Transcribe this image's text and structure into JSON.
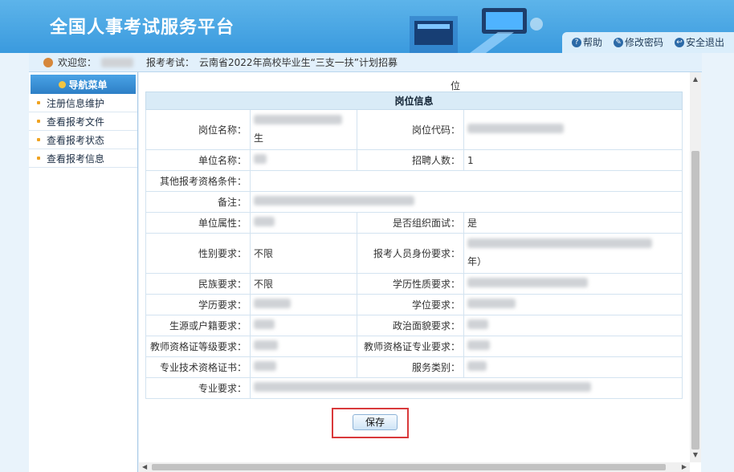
{
  "header": {
    "title": "全国人事考试服务平台",
    "links": [
      {
        "icon": "help-icon",
        "label": "帮助"
      },
      {
        "icon": "key-icon",
        "label": "修改密码"
      },
      {
        "icon": "exit-icon",
        "label": "安全退出"
      }
    ]
  },
  "welcome": {
    "greeting": "欢迎您：",
    "exam_label": "报考考试：",
    "exam_name": "云南省2022年高校毕业生“三支一扶”计划招募"
  },
  "sidebar": {
    "title": "导航菜单",
    "items": [
      {
        "label": "注册信息维护"
      },
      {
        "label": "查看报考文件"
      },
      {
        "label": "查看报考状态"
      },
      {
        "label": "查看报考信息"
      }
    ]
  },
  "content": {
    "top_fragment": "位",
    "section_title": "岗位信息",
    "rows": [
      {
        "l1": "岗位名称：",
        "v1": "生",
        "l2": "岗位代码：",
        "v2": ""
      },
      {
        "l1": "单位名称：",
        "v1": "",
        "l2": "招聘人数：",
        "v2": "1"
      },
      {
        "l1": "其他报考资格条件：",
        "v1": ""
      },
      {
        "l1": "备注：",
        "v1": ""
      },
      {
        "l1": "单位属性：",
        "v1": "",
        "l2": "是否组织面试：",
        "v2": "是"
      },
      {
        "l1": "性别要求：",
        "v1": "不限",
        "l2": "报考人员身份要求：",
        "v2": "年）"
      },
      {
        "l1": "民族要求：",
        "v1": "不限",
        "l2": "学历性质要求：",
        "v2": ""
      },
      {
        "l1": "学历要求：",
        "v1": "",
        "l2": "学位要求：",
        "v2": ""
      },
      {
        "l1": "生源或户籍要求：",
        "v1": "",
        "l2": "政治面貌要求：",
        "v2": ""
      },
      {
        "l1": "教师资格证等级要求：",
        "v1": "",
        "l2": "教师资格证专业要求：",
        "v2": ""
      },
      {
        "l1": "专业技术资格证书：",
        "v1": "",
        "l2": "服务类别：",
        "v2": ""
      },
      {
        "l1": "专业要求：",
        "v1": ""
      }
    ],
    "save_label": "保存"
  },
  "colors": {
    "header_bg": "#3a9ade",
    "highlight_border": "#d9393b",
    "table_header_bg": "#d9ebf7"
  }
}
